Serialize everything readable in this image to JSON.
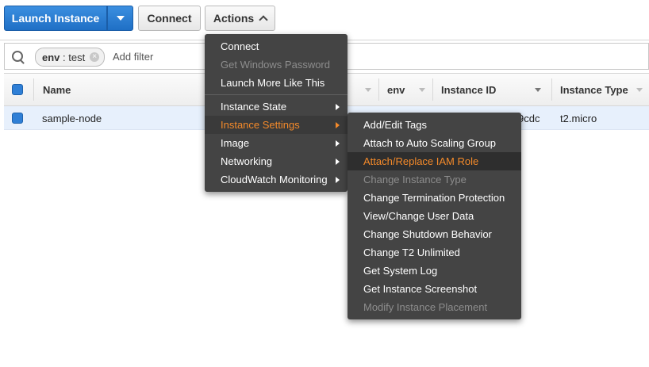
{
  "toolbar": {
    "launch_label": "Launch Instance",
    "connect_label": "Connect",
    "actions_label": "Actions"
  },
  "filter": {
    "tag_key": "env",
    "tag_value": "test",
    "placeholder": "Add filter"
  },
  "table": {
    "columns": {
      "name": "Name",
      "env": "env",
      "instance_id": "Instance ID",
      "instance_type": "Instance Type"
    },
    "rows": [
      {
        "name": "sample-node",
        "instance_id_visible": "9cdc",
        "instance_type": "t2.micro"
      }
    ]
  },
  "actions_menu": {
    "items": [
      {
        "label": "Connect",
        "state": "enabled"
      },
      {
        "label": "Get Windows Password",
        "state": "disabled"
      },
      {
        "label": "Launch More Like This",
        "state": "enabled"
      },
      {
        "label": "Instance State",
        "state": "submenu"
      },
      {
        "label": "Instance Settings",
        "state": "active"
      },
      {
        "label": "Image",
        "state": "submenu"
      },
      {
        "label": "Networking",
        "state": "submenu"
      },
      {
        "label": "CloudWatch Monitoring",
        "state": "submenu"
      }
    ]
  },
  "settings_menu": {
    "items": [
      {
        "label": "Add/Edit Tags",
        "state": "enabled"
      },
      {
        "label": "Attach to Auto Scaling Group",
        "state": "enabled"
      },
      {
        "label": "Attach/Replace IAM Role",
        "state": "highlighted"
      },
      {
        "label": "Change Instance Type",
        "state": "disabled"
      },
      {
        "label": "Change Termination Protection",
        "state": "enabled"
      },
      {
        "label": "View/Change User Data",
        "state": "enabled"
      },
      {
        "label": "Change Shutdown Behavior",
        "state": "enabled"
      },
      {
        "label": "Change T2 Unlimited",
        "state": "enabled"
      },
      {
        "label": "Get System Log",
        "state": "enabled"
      },
      {
        "label": "Get Instance Screenshot",
        "state": "enabled"
      },
      {
        "label": "Modify Instance Placement",
        "state": "disabled"
      }
    ]
  },
  "colors": {
    "primary": "#1f6fc5",
    "menu_bg": "#444444",
    "menu_active": "#f48a2a",
    "selected_row": "#e7f0fc"
  }
}
